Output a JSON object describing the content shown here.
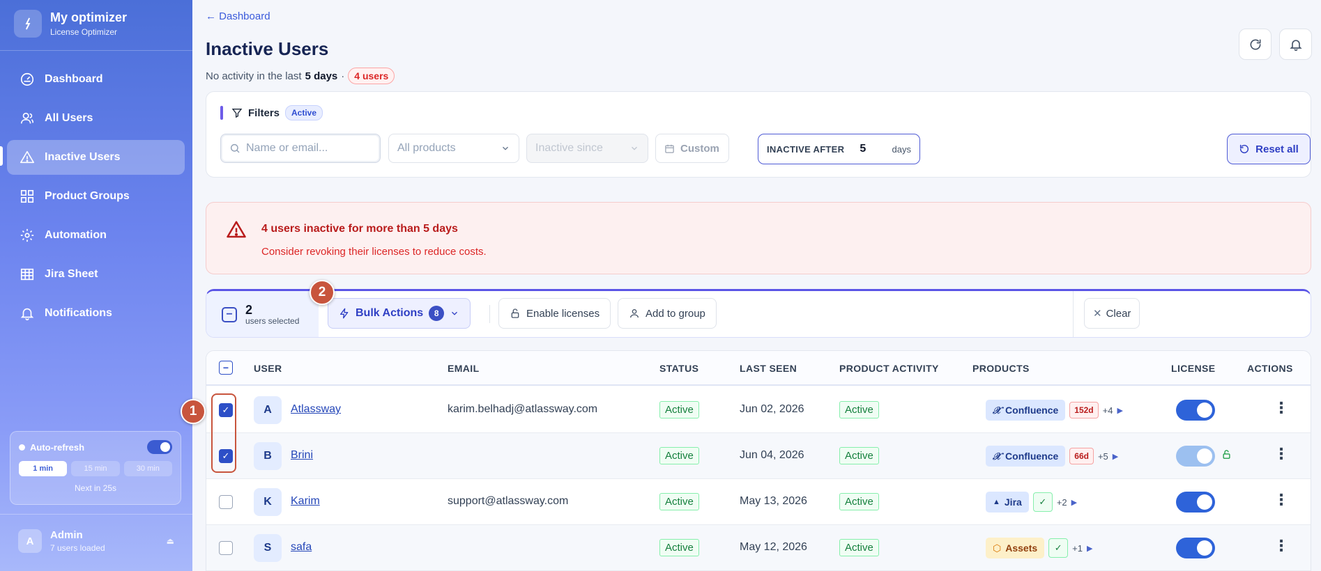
{
  "sidebar": {
    "brand_title": "My optimizer",
    "brand_sub": "License Optimizer",
    "items": [
      {
        "label": "Dashboard",
        "icon": "gauge-icon"
      },
      {
        "label": "All Users",
        "icon": "users-icon"
      },
      {
        "label": "Inactive Users",
        "icon": "warning-icon",
        "active": true
      },
      {
        "label": "Product Groups",
        "icon": "grid-icon"
      },
      {
        "label": "Automation",
        "icon": "gear-icon"
      },
      {
        "label": "Jira Sheet",
        "icon": "table-icon"
      },
      {
        "label": "Notifications",
        "icon": "bell-icon"
      }
    ],
    "autorefresh": {
      "title": "Auto-refresh",
      "options": [
        "1 min",
        "15 min",
        "30 min"
      ],
      "selected": "1 min",
      "next": "Next in 25s"
    },
    "admin": {
      "initial": "A",
      "name": "Admin",
      "sub": "7 users loaded"
    }
  },
  "header": {
    "back": "← Dashboard",
    "title": "Inactive Users",
    "subtitle_prefix": "No activity in the last",
    "subtitle_days": "5 days",
    "subtitle_sep": "·",
    "users_badge": "4 users"
  },
  "filters": {
    "title": "Filters",
    "badge": "Active",
    "search_placeholder": "Name or email...",
    "products": "All products",
    "inactive_since": "Inactive since",
    "custom": "Custom",
    "inactive_after_label": "INACTIVE AFTER",
    "inactive_after_value": "5",
    "inactive_after_unit": "days",
    "reset": "Reset all"
  },
  "alert": {
    "title": "4 users inactive for more than 5 days",
    "sub": "Consider revoking their licenses to reduce costs."
  },
  "bulk": {
    "count": "2",
    "label": "users selected",
    "bulk_actions": "Bulk Actions",
    "bulk_count": "8",
    "enable": "Enable licenses",
    "add_group": "Add to group",
    "clear": "Clear"
  },
  "steps": {
    "one": "1",
    "two": "2"
  },
  "table": {
    "headers": {
      "user": "USER",
      "email": "EMAIL",
      "status": "STATUS",
      "last_seen": "LAST SEEN",
      "activity": "PRODUCT ACTIVITY",
      "products": "PRODUCTS",
      "license": "LICENSE",
      "actions": "ACTIONS"
    },
    "rows": [
      {
        "initial": "A",
        "name": "Atlassway",
        "email": "karim.belhadj@atlassway.com",
        "status": "Active",
        "last_seen": "Jun 02, 2026",
        "activity": "Active",
        "product": "Confluence",
        "product_glyph": "𝒳",
        "days": "152d",
        "more": "+4"
      },
      {
        "initial": "B",
        "name": "Brini",
        "email": "",
        "status": "Active",
        "last_seen": "Jun 04, 2026",
        "activity": "Active",
        "product": "Confluence",
        "product_glyph": "𝒳",
        "days": "66d",
        "more": "+5"
      },
      {
        "initial": "K",
        "name": "Karim",
        "email": "support@atlassway.com",
        "status": "Active",
        "last_seen": "May 13, 2026",
        "activity": "Active",
        "product": "Jira",
        "product_glyph": "▲",
        "days": "✓",
        "more": "+2"
      },
      {
        "initial": "S",
        "name": "safa",
        "email": "",
        "status": "Active",
        "last_seen": "May 12, 2026",
        "activity": "Active",
        "product": "Assets",
        "product_glyph": "⬡",
        "days": "✓",
        "more": "+1"
      }
    ]
  },
  "colors": {
    "accent": "#3b4fc4",
    "danger": "#dc2626",
    "success": "#15803d"
  }
}
